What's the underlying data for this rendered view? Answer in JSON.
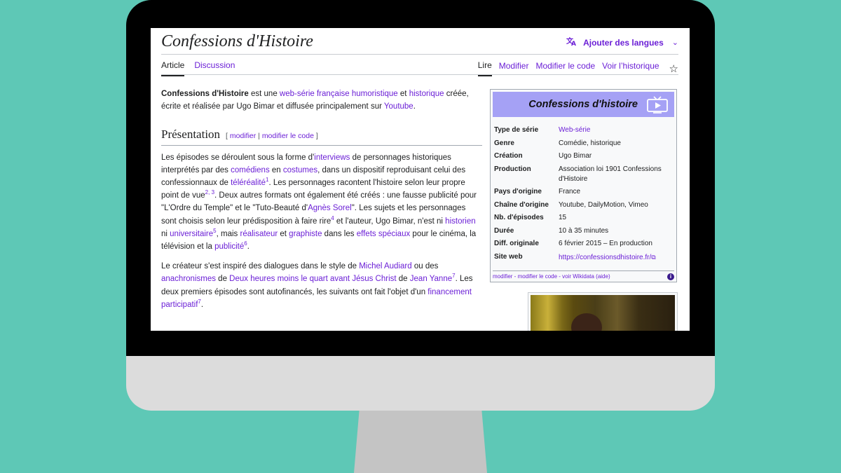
{
  "page": {
    "title": "Confessions d'Histoire",
    "lang_button": "Ajouter des langues"
  },
  "tabs": {
    "left": [
      "Article",
      "Discussion"
    ],
    "right": [
      "Lire",
      "Modifier",
      "Modifier le code",
      "Voir l’historique"
    ]
  },
  "intro": {
    "subject": "Confessions d'Histoire",
    "t1": " est une ",
    "l1": "web-série",
    "t2": " ",
    "l2": "française",
    "t3": " ",
    "l3": "humoristique",
    "t4": " et ",
    "l4": "historique",
    "t5": " créée, écrite et réalisée par Ugo Bimar et diffusée principalement sur ",
    "l5": "Youtube",
    "t6": "."
  },
  "section": {
    "title": "Présentation",
    "edit_open": "[ ",
    "edit_link1": "modifier",
    "edit_sep": " | ",
    "edit_link2": "modifier le code",
    "edit_close": " ]"
  },
  "para1": {
    "t1": "Les épisodes se déroulent sous la forme d'",
    "l1": "interviews",
    "t2": " de personnages historiques interprétés par des ",
    "l2": "comédiens",
    "t3": " en ",
    "l3": "costumes",
    "t4": ", dans un dispositif reproduisant celui des confessionnaux de ",
    "l4": "téléréalité",
    "s1": "1",
    "t5": ". Les personnages racontent l'histoire selon leur propre point de vue",
    "s2": "2, 3",
    "t6": ". Deux autres formats ont également été créés : une fausse publicité pour \"L'Ordre du Temple\" et le \"Tuto-Beauté d'",
    "l5": "Agnès Sorel",
    "t7": "\". Les sujets et les personnages sont choisis selon leur prédisposition à faire rire",
    "s3": "4",
    "t8": " et l'auteur, Ugo Bimar, n'est ni ",
    "l6": "historien",
    "t9": " ni ",
    "l7": "universitaire",
    "s4": "5",
    "t10": ", mais ",
    "l8": "réalisateur",
    "t11": " et ",
    "l9": "graphiste",
    "t12": " dans les ",
    "l10": "effets spéciaux",
    "t13": " pour le cinéma, la télévision et la ",
    "l11": "publicité",
    "s5": "6",
    "t14": "."
  },
  "para2": {
    "t1": "Le créateur s'est inspiré des dialogues dans le style de ",
    "l1": "Michel Audiard",
    "t2": " ou des ",
    "l2": "anachronismes",
    "t3": " de ",
    "l3": "Deux heures moins le quart avant Jésus Christ",
    "t4": " de ",
    "l4": "Jean Yanne",
    "s1": "7",
    "t5": ". Les deux premiers épisodes sont autofinancés, les suivants ont fait l'objet d'un ",
    "l5": "financement participatif",
    "s2": "7",
    "t6": "."
  },
  "infobox": {
    "title": "Confessions d'histoire",
    "rows": [
      {
        "key": "Type de série",
        "value": "Web-série"
      },
      {
        "key": "Genre",
        "value": "Comédie, historique"
      },
      {
        "key": "Création",
        "value": "Ugo Bimar"
      },
      {
        "key": "Production",
        "value": "Association loi 1901 Confessions d'Histoire"
      },
      {
        "key": "Pays d'origine",
        "value": "France"
      },
      {
        "key": "Chaîne d'origine",
        "value": "Youtube, DailyMotion, Vimeo"
      },
      {
        "key": "Nb. d'épisodes",
        "value": "15"
      },
      {
        "key": "Durée",
        "value": "10 à 35 minutes"
      },
      {
        "key": "Diff. originale",
        "value": "6 février 2015 – En production"
      },
      {
        "key": "Site web",
        "value": "https://confessionsdhistoire.fr/"
      }
    ],
    "footer": "modifier - modifier le code - voir Wikidata (aide)",
    "info_glyph": "i"
  },
  "colors": {
    "background": "#5ec8b6",
    "link": "#6b1fd6",
    "infobox_header": "#a5a1f5"
  },
  "icons": [
    "translate-icon",
    "chevron-down-icon",
    "star-icon",
    "tv-icon",
    "external-link-icon",
    "info-icon"
  ]
}
